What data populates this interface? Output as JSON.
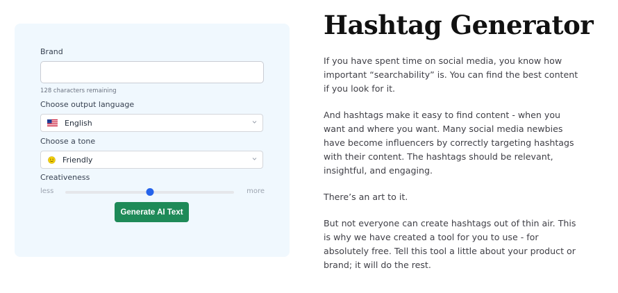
{
  "form": {
    "brand_label": "Brand",
    "brand_value": "",
    "brand_helper": "128 characters remaining",
    "language_label": "Choose output language",
    "language_value": "English",
    "tone_label": "Choose a tone",
    "tone_value": "Friendly",
    "creativeness_label": "Creativeness",
    "slider_less": "less",
    "slider_more": "more",
    "creativeness_level": 0.5,
    "generate_label": "Generate AI Text"
  },
  "article": {
    "title": "Hashtag Generator",
    "paragraphs": [
      "If you have spent time on social media, you know how important “searchability” is. You can find the best content if you look for it.",
      "And hashtags make it easy to find content - when you want and where you want. Many social media newbies have become influencers by correctly targeting hashtags with their content. The hashtags should be relevant, insightful, and engaging.",
      "There’s an art to it.",
      "But not everyone can create hashtags out of thin air. This is why we have created a tool for you to use - for absolutely free. Tell this tool a little about your product or brand; it will do the rest."
    ]
  },
  "icons": {
    "language": "us-flag-icon",
    "tone": "smiley-icon",
    "dropdown": "chevron-down-icon"
  },
  "colors": {
    "panel_bg": "#f0f8fe",
    "button_bg": "#1e8a58",
    "slider_thumb": "#2563eb"
  }
}
